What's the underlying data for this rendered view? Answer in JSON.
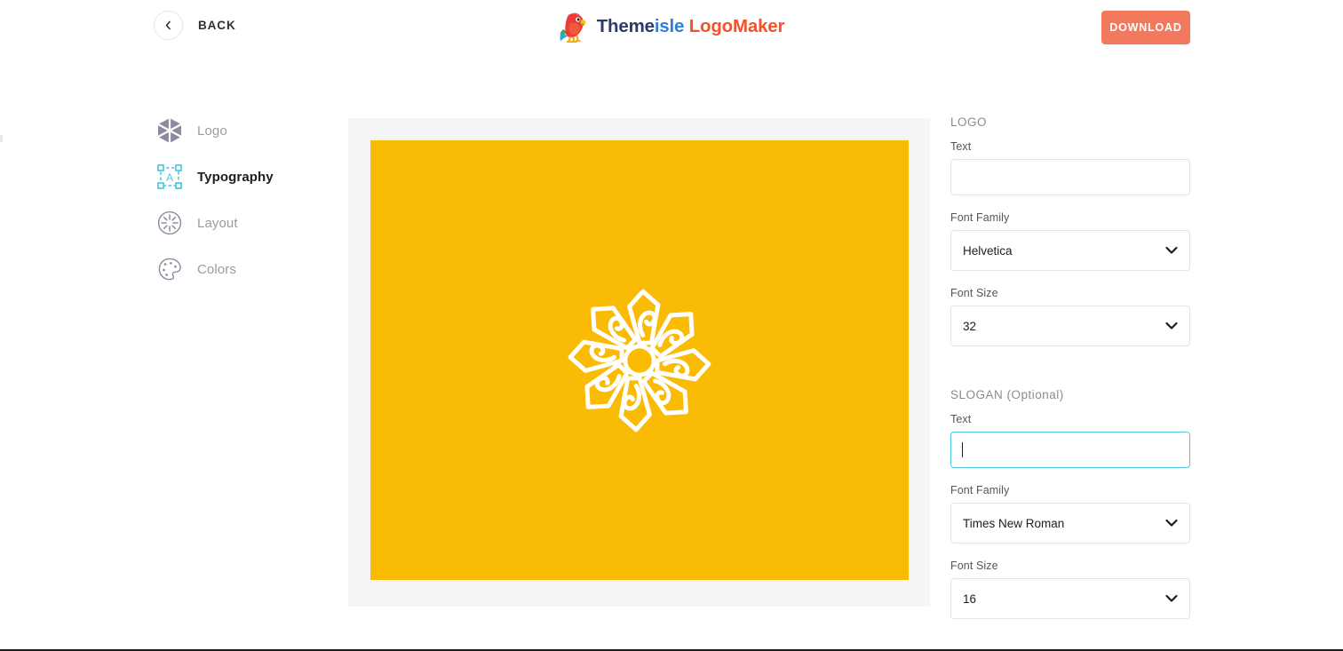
{
  "header": {
    "back_label": "BACK",
    "back_icon": "chevron-left-icon",
    "brand": {
      "icon": "parrot-icon",
      "part1": "Theme",
      "part2": "isle",
      "space": " ",
      "part3": "LogoMaker",
      "color_part1": "#2b3a67",
      "color_part2": "#2e7fe0",
      "color_part3": "#f4512c"
    },
    "download_label": "DOWNLOAD",
    "download_color": "#f3795e"
  },
  "sidebar": {
    "items": [
      {
        "label": "Logo",
        "icon": "hexagon-cube-icon",
        "active": false
      },
      {
        "label": "Typography",
        "icon": "text-box-icon",
        "active": true
      },
      {
        "label": "Layout",
        "icon": "layout-burst-icon",
        "active": false
      },
      {
        "label": "Colors",
        "icon": "palette-icon",
        "active": false
      }
    ]
  },
  "preview": {
    "background_color": "#fabb05",
    "container_color": "#f4f5f7",
    "symbol": "flower-outline-icon",
    "symbol_color": "#ffffff"
  },
  "panel": {
    "logo_section": {
      "title": "LOGO",
      "text_label": "Text",
      "text_value": "",
      "text_placeholder": "",
      "font_family_label": "Font Family",
      "font_family_value": "Helvetica",
      "font_size_label": "Font Size",
      "font_size_value": "32"
    },
    "slogan_section": {
      "title": "SLOGAN (Optional)",
      "text_label": "Text",
      "text_value": "",
      "text_placeholder": "",
      "text_focused": true,
      "focus_color": "#4ec8dd",
      "font_family_label": "Font Family",
      "font_family_value": "Times New Roman",
      "font_size_label": "Font Size",
      "font_size_value": "16"
    }
  }
}
